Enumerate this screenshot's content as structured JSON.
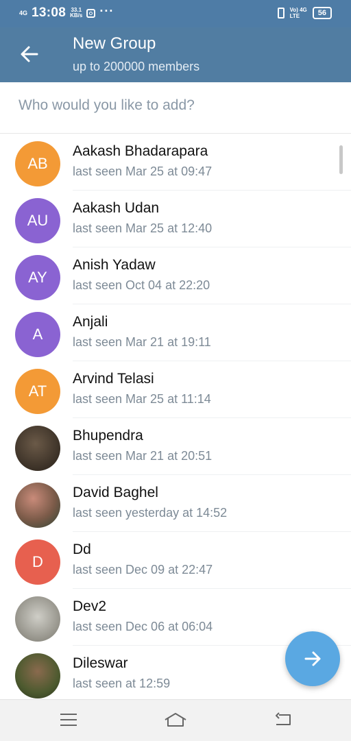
{
  "status_bar": {
    "signal": "4G",
    "time": "13:08",
    "speed_value": "33.1",
    "speed_unit": "KB/s",
    "more": "···",
    "network": "Vo) 4G",
    "network2": "LTE",
    "battery": "56"
  },
  "header": {
    "title": "New Group",
    "subtitle": "up to 200000 members"
  },
  "search": {
    "placeholder": "Who would you like to add?"
  },
  "colors": {
    "header": "#517da2",
    "statusbar": "#4e7ca6",
    "fab": "#5aa8e2",
    "orange": "#f39a36",
    "purple": "#8a63d2",
    "red": "#e7604f"
  },
  "contacts": [
    {
      "initials": "AB",
      "name": "Aakash Bhadarapara",
      "status": "last seen Mar 25 at 09:47",
      "avatar_color": "#f39a36"
    },
    {
      "initials": "AU",
      "name": "Aakash Udan",
      "status": "last seen Mar 25 at 12:40",
      "avatar_color": "#8a63d2"
    },
    {
      "initials": "AY",
      "name": "Anish Yadaw",
      "status": "last seen Oct 04 at 22:20",
      "avatar_color": "#8a63d2"
    },
    {
      "initials": "A",
      "name": "Anjali",
      "status": "last seen Mar 21 at 19:11",
      "avatar_color": "#8a63d2"
    },
    {
      "initials": "AT",
      "name": "Arvind Telasi",
      "status": "last seen Mar 25 at 11:14",
      "avatar_color": "#f39a36"
    },
    {
      "initials": "",
      "name": "Bhupendra",
      "status": "last seen Mar 21 at 20:51",
      "avatar_color": "#4a4033"
    },
    {
      "initials": "",
      "name": "David Baghel",
      "status": "last seen yesterday at 14:52",
      "avatar_color": "#7e6a5a"
    },
    {
      "initials": "D",
      "name": "Dd",
      "status": "last seen Dec 09 at 22:47",
      "avatar_color": "#e7604f"
    },
    {
      "initials": "",
      "name": "Dev2",
      "status": "last seen Dec 06 at 06:04",
      "avatar_color": "#a6a49c"
    },
    {
      "initials": "",
      "name": "Dileswar",
      "status": "last seen at 12:59",
      "avatar_color": "#5b6a3c"
    }
  ],
  "icons": {
    "back": "arrow-left-icon",
    "fab": "arrow-right-icon",
    "nav_menu": "menu-icon",
    "nav_home": "home-icon",
    "nav_back": "back-icon"
  }
}
